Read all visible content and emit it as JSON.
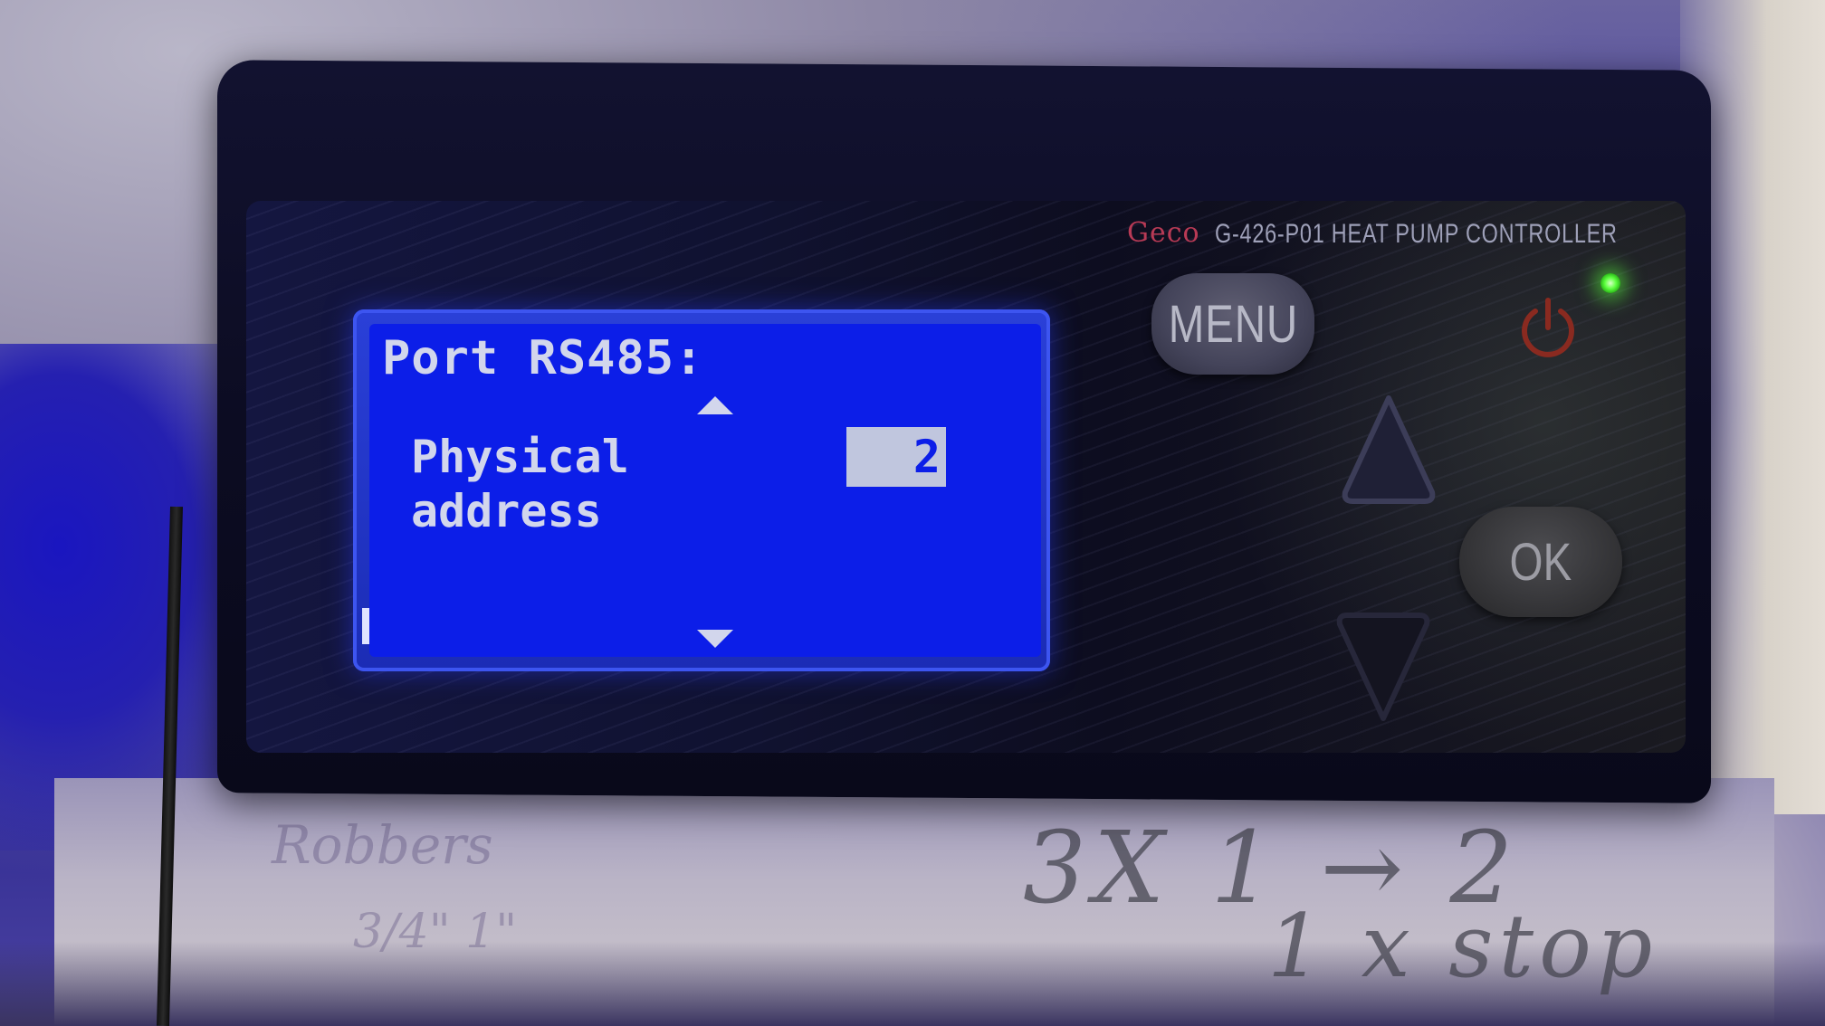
{
  "device": {
    "brand": "Geco",
    "model": "G-426-P01 HEAT PUMP CONTROLLER"
  },
  "lcd": {
    "title": "Port RS485:",
    "label_line1": "Physical",
    "label_line2": "address",
    "value": "2"
  },
  "buttons": {
    "menu_label": "MENU",
    "ok_label": "OK",
    "up_icon": "triangle-up-icon",
    "down_icon": "triangle-down-icon",
    "power_icon": "power-icon"
  },
  "indicators": {
    "power_led_color": "#5cff3e"
  },
  "handwriting": {
    "note1": "Robbers",
    "note2": "3/4\"  1\"",
    "note3": "3X 1 → 2",
    "note4": "1 x stop"
  },
  "colors": {
    "lcd_background": "#0c1ee8",
    "lcd_text": "#d2d6ec",
    "brand_red": "#b83a55"
  }
}
